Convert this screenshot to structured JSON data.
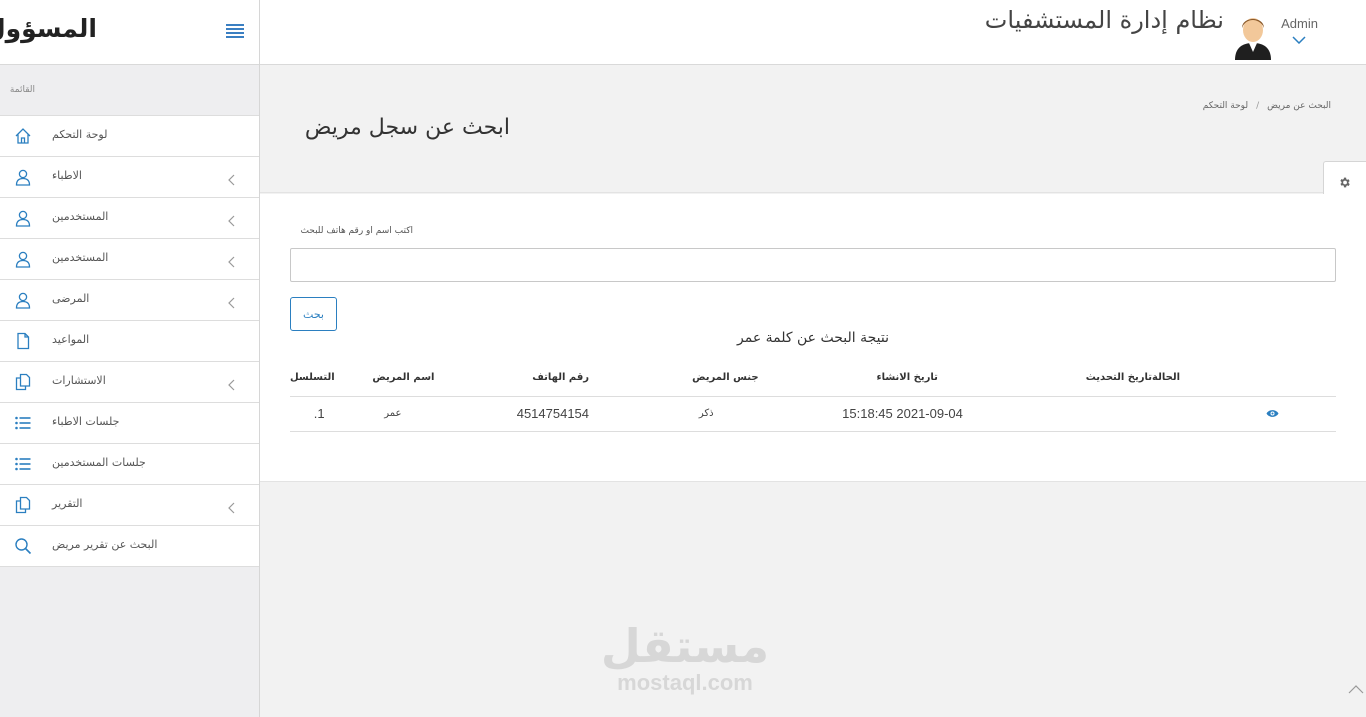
{
  "header": {
    "site_title": "نظام إدارة المستشفيات",
    "user_name": "Admin"
  },
  "sidebar": {
    "title": "المسؤول",
    "caption": "القائمة",
    "items": [
      {
        "label": "لوحة التحكم",
        "icon": "home-icon",
        "has_children": false
      },
      {
        "label": "الاطباء",
        "icon": "user-icon",
        "has_children": true
      },
      {
        "label": "المستخدمين",
        "icon": "user-icon",
        "has_children": true
      },
      {
        "label": "المستخدمين",
        "icon": "user-icon",
        "has_children": true
      },
      {
        "label": "المرضى",
        "icon": "user-icon",
        "has_children": true
      },
      {
        "label": "المواعيد",
        "icon": "document-icon",
        "has_children": false
      },
      {
        "label": "الاستشارات",
        "icon": "copy-icon",
        "has_children": true
      },
      {
        "label": "جلسات الاطباء",
        "icon": "list-icon",
        "has_children": false
      },
      {
        "label": "جلسات المستخدمين",
        "icon": "list-icon",
        "has_children": false
      },
      {
        "label": "التقرير",
        "icon": "copy-icon",
        "has_children": true
      },
      {
        "label": "البحث عن تقرير مريض",
        "icon": "search-icon",
        "has_children": false
      }
    ]
  },
  "page": {
    "title": "ابحث عن سجل مريض",
    "breadcrumb": [
      "لوحة التحكم",
      "البحث عن مريض"
    ]
  },
  "search": {
    "label": "اكتب اسم او رقم هاتف للبحث",
    "value": "",
    "button_label": "بحث",
    "result_title": "نتيجة البحث عن كلمة عمر"
  },
  "table": {
    "headers": [
      "التسلسل",
      "اسم المريض",
      "رقم الهاتف",
      "جنس المريض",
      "تاريخ الانشاء",
      "تاريخ التحديث",
      "الحالة"
    ],
    "rows": [
      {
        "seq": "1.",
        "name": "عمر",
        "phone": "4514754154",
        "gender": "ذكر",
        "created": "2021-09-04 15:18:45",
        "updated": "",
        "status_icon": "eye-icon"
      }
    ]
  },
  "watermark": {
    "ar": "مستقل",
    "en": "mostaql.com"
  },
  "colors": {
    "accent": "#2b7fc0",
    "sidebar_bg": "#eeeef0",
    "content_bg": "#f2f2f2"
  }
}
